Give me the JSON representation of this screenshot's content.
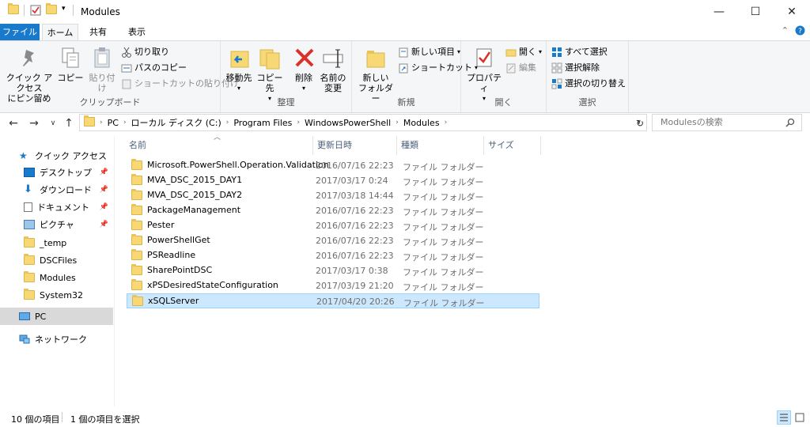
{
  "window": {
    "title": "Modules",
    "controls": {
      "minimize": "—",
      "maximize": "☐",
      "close": "✕"
    }
  },
  "ribbon_tabs": {
    "file": "ファイル",
    "home": "ホーム",
    "share": "共有",
    "view": "表示"
  },
  "ribbon": {
    "clipboard": {
      "label": "クリップボード",
      "pin_quick_access_line1": "クイック アクセス",
      "pin_quick_access_line2": "にピン留め",
      "copy": "コピー",
      "paste": "貼り付け",
      "cut": "切り取り",
      "copy_path": "パスのコピー",
      "paste_shortcut": "ショートカットの貼り付け"
    },
    "organize": {
      "label": "整理",
      "move_to": "移動先",
      "copy_to": "コピー先",
      "delete": "削除",
      "rename_line1": "名前の",
      "rename_line2": "変更"
    },
    "new": {
      "label": "新規",
      "new_folder_line1": "新しい",
      "new_folder_line2": "フォルダー",
      "new_item": "新しい項目",
      "shortcut": "ショートカット"
    },
    "open": {
      "label": "開く",
      "properties": "プロパティ",
      "open": "開く",
      "edit": "編集"
    },
    "select": {
      "label": "選択",
      "select_all": "すべて選択",
      "select_none": "選択解除",
      "invert": "選択の切り替え"
    }
  },
  "address": {
    "crumbs": [
      "PC",
      "ローカル ディスク (C:)",
      "Program Files",
      "WindowsPowerShell",
      "Modules"
    ],
    "search_placeholder": "Modulesの検索"
  },
  "navpane": {
    "quick_access": "クイック アクセス",
    "pinned": [
      "デスクトップ",
      "ダウンロード",
      "ドキュメント",
      "ピクチャ"
    ],
    "folders": [
      "_temp",
      "DSCFiles",
      "Modules",
      "System32"
    ],
    "pc": "PC",
    "network": "ネットワーク"
  },
  "columns": {
    "name": "名前",
    "date": "更新日時",
    "type": "種類",
    "size": "サイズ"
  },
  "files": [
    {
      "name": "Microsoft.PowerShell.Operation.Validation",
      "date": "2016/07/16 22:23",
      "type": "ファイル フォルダー"
    },
    {
      "name": "MVA_DSC_2015_DAY1",
      "date": "2017/03/17 0:24",
      "type": "ファイル フォルダー"
    },
    {
      "name": "MVA_DSC_2015_DAY2",
      "date": "2017/03/18 14:44",
      "type": "ファイル フォルダー"
    },
    {
      "name": "PackageManagement",
      "date": "2016/07/16 22:23",
      "type": "ファイル フォルダー"
    },
    {
      "name": "Pester",
      "date": "2016/07/16 22:23",
      "type": "ファイル フォルダー"
    },
    {
      "name": "PowerShellGet",
      "date": "2016/07/16 22:23",
      "type": "ファイル フォルダー"
    },
    {
      "name": "PSReadline",
      "date": "2016/07/16 22:23",
      "type": "ファイル フォルダー"
    },
    {
      "name": "SharePointDSC",
      "date": "2017/03/17 0:38",
      "type": "ファイル フォルダー"
    },
    {
      "name": "xPSDesiredStateConfiguration",
      "date": "2017/03/19 21:20",
      "type": "ファイル フォルダー"
    },
    {
      "name": "xSQLServer",
      "date": "2017/04/20 20:26",
      "type": "ファイル フォルダー"
    }
  ],
  "status": {
    "item_count": "10 個の項目",
    "selected": "1 個の項目を選択"
  }
}
